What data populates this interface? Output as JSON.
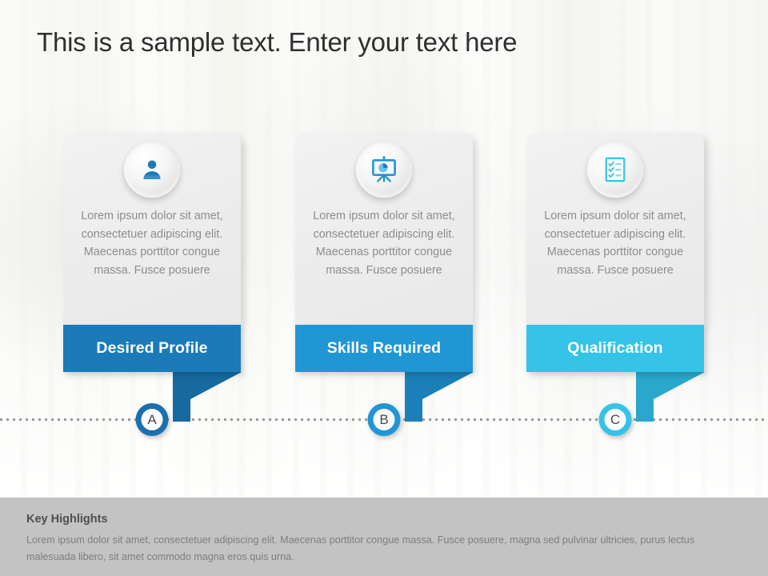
{
  "title": "This is a sample text. Enter your text here",
  "cards": [
    {
      "icon": "person-icon",
      "body": "Lorem ipsum dolor sit amet, consectetuer adipiscing elit. Maecenas porttitor congue massa. Fusce posuere",
      "label": "Desired Profile",
      "badge": "A",
      "color": "#1b7ab8",
      "tail_color": "#166a9f",
      "badge_ring": "#1b6fae"
    },
    {
      "icon": "presentation-chart-icon",
      "body": "Lorem ipsum dolor sit amet, consectetuer adipiscing elit. Maecenas porttitor congue massa. Fusce posuere",
      "label": "Skills Required",
      "badge": "B",
      "color": "#2196d4",
      "tail_color": "#1b80b8",
      "badge_ring": "#2196d4"
    },
    {
      "icon": "checklist-icon",
      "body": "Lorem ipsum dolor sit amet, consectetuer adipiscing elit. Maecenas porttitor congue massa. Fusce posuere",
      "label": "Qualification",
      "badge": "C",
      "color": "#35c3e8",
      "tail_color": "#2aa8cb",
      "badge_ring": "#35c3e8"
    }
  ],
  "footer": {
    "title": "Key Highlights",
    "text": "Lorem ipsum dolor sit amet, consectetuer adipiscing elit. Maecenas porttitor congue massa. Fusce posuere, magna sed pulvinar ultricies, purus lectus malesuada libero, sit amet commodo magna eros quis urna."
  }
}
